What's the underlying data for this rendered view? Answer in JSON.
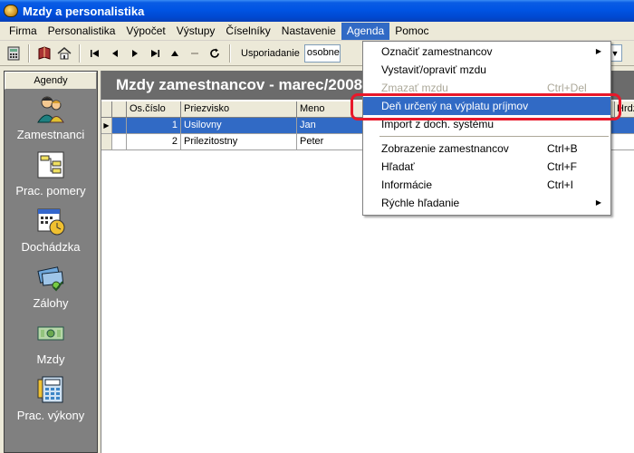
{
  "window": {
    "title": "Mzdy a personalistika"
  },
  "menubar": {
    "items": [
      {
        "label": "Firma"
      },
      {
        "label": "Personalistika"
      },
      {
        "label": "Výpočet"
      },
      {
        "label": "Výstupy"
      },
      {
        "label": "Číselníky"
      },
      {
        "label": "Nastavenie"
      },
      {
        "label": "Agenda"
      },
      {
        "label": "Pomoc"
      }
    ]
  },
  "toolbar": {
    "usporiadanie_label": "Usporiadanie",
    "usporiadanie_value": "osobne"
  },
  "agendy": {
    "header": "Agendy",
    "items": [
      {
        "label": "Zamestnanci",
        "icon": "people-icon"
      },
      {
        "label": "Prac. pomery",
        "icon": "org-chart-icon"
      },
      {
        "label": "Dochádzka",
        "icon": "calendar-clock-icon"
      },
      {
        "label": "Zálohy",
        "icon": "money-icon"
      },
      {
        "label": "Mzdy",
        "icon": "banknote-icon"
      },
      {
        "label": "Prac. výkony",
        "icon": "calculator-icon"
      }
    ]
  },
  "main": {
    "header": "Mzdy zamestnancov - marec/2008",
    "columns": [
      "Os.číslo",
      "Priezvisko",
      "Meno"
    ],
    "right_col_header": "Hrdz",
    "rows": [
      {
        "os_cislo": "1",
        "priezvisko": "Usilovny",
        "meno": "Jan",
        "selected": true
      },
      {
        "os_cislo": "2",
        "priezvisko": "Prilezitostny",
        "meno": "Peter",
        "selected": false
      }
    ]
  },
  "agenda_menu": {
    "items": [
      {
        "label": "Označiť zamestnancov",
        "shortcut": "",
        "submenu": true,
        "disabled": false
      },
      {
        "label": "Vystaviť/opraviť mzdu",
        "shortcut": "",
        "submenu": false,
        "disabled": false
      },
      {
        "label": "Zmazať mzdu",
        "shortcut": "Ctrl+Del",
        "submenu": false,
        "disabled": true
      },
      {
        "label": "Deň určený na výplatu príjmov",
        "shortcut": "",
        "submenu": false,
        "disabled": false,
        "highlighted": true
      },
      {
        "label": "Import z doch. systému",
        "shortcut": "",
        "submenu": false,
        "disabled": false
      },
      {
        "separator": true
      },
      {
        "label": "Zobrazenie zamestnancov",
        "shortcut": "Ctrl+B",
        "submenu": false,
        "disabled": false
      },
      {
        "label": "Hľadať",
        "shortcut": "Ctrl+F",
        "submenu": false,
        "disabled": false
      },
      {
        "label": "Informácie",
        "shortcut": "Ctrl+I",
        "submenu": false,
        "disabled": false
      },
      {
        "label": "Rýchle hľadanie",
        "shortcut": "",
        "submenu": true,
        "disabled": false
      }
    ]
  },
  "colors": {
    "selection": "#316ac5",
    "highlight_ring": "#e8182a",
    "agenda_panel": "#808080"
  }
}
